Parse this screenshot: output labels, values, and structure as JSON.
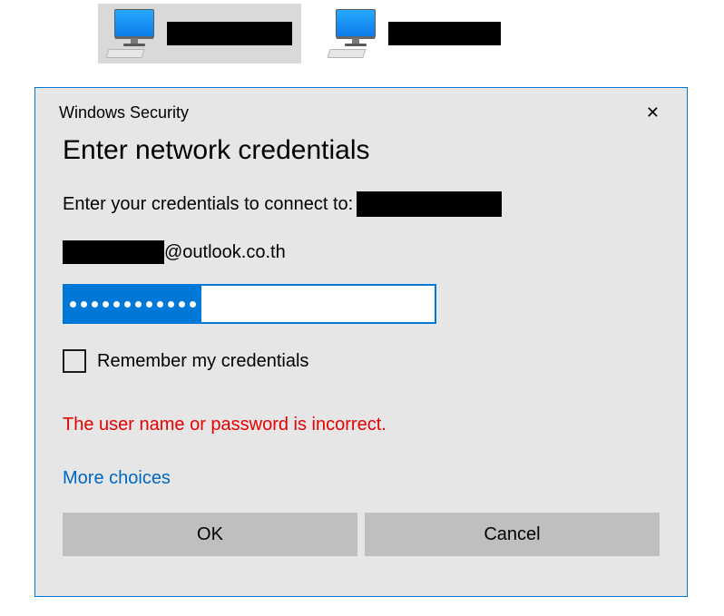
{
  "network": {
    "item1_label": "",
    "item2_label": ""
  },
  "dialog": {
    "header_title": "Windows Security",
    "close_glyph": "✕",
    "title": "Enter network credentials",
    "connect_prefix": "Enter your credentials to connect to:",
    "target_name": "",
    "email_user": "",
    "email_domain": "@outlook.co.th",
    "password_value": "••••••••••••",
    "remember_label": "Remember my credentials",
    "error_message": "The user name or password is incorrect.",
    "more_choices": "More choices",
    "ok_label": "OK",
    "cancel_label": "Cancel"
  }
}
